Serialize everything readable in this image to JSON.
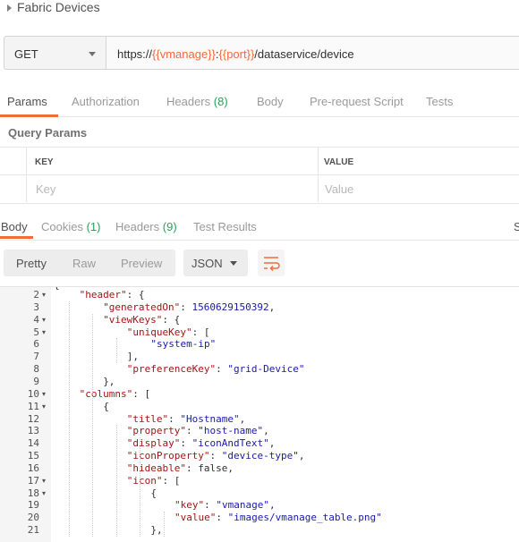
{
  "request": {
    "title": "Fabric Devices",
    "method": "GET",
    "url": {
      "prefix": "https://",
      "var1": "{{vmanage}}",
      "sep": ":",
      "var2": "{{port}}",
      "path": "/dataservice/device"
    }
  },
  "request_tabs": {
    "params": "Params",
    "authorization": "Authorization",
    "headers": "Headers",
    "headers_count": "(8)",
    "body": "Body",
    "prerequest": "Pre-request Script",
    "tests": "Tests"
  },
  "query_params": {
    "title": "Query Params",
    "key_header": "KEY",
    "value_header": "VALUE",
    "key_placeholder": "Key",
    "value_placeholder": "Value"
  },
  "response_tabs": {
    "body": "Body",
    "cookies": "Cookies",
    "cookies_count": "(1)",
    "headers": "Headers",
    "headers_count": "(9)",
    "test_results": "Test Results",
    "status_partial": "S"
  },
  "toolbar": {
    "pretty": "Pretty",
    "raw": "Raw",
    "preview": "Preview",
    "format": "JSON",
    "wrap_icon": "wrap-lines-icon"
  },
  "code": {
    "top_partial": "{",
    "lines": [
      {
        "n": "2",
        "fold": true,
        "key": "\"header\"",
        "rest": ": {"
      },
      {
        "n": "3",
        "fold": false,
        "key": "\"generatedOn\"",
        "rest": ": ",
        "num": "1560629150392",
        "tail": ","
      },
      {
        "n": "4",
        "fold": true,
        "key": "\"viewKeys\"",
        "rest": ": {"
      },
      {
        "n": "5",
        "fold": true,
        "key": "\"uniqueKey\"",
        "rest": ": ["
      },
      {
        "n": "6",
        "fold": false,
        "str": "\"system-ip\""
      },
      {
        "n": "7",
        "fold": false,
        "plain": "],"
      },
      {
        "n": "8",
        "fold": false,
        "key": "\"preferenceKey\"",
        "rest": ": ",
        "str": "\"grid-Device\""
      },
      {
        "n": "9",
        "fold": false,
        "plain": "},"
      },
      {
        "n": "10",
        "fold": true,
        "key": "\"columns\"",
        "rest": ": ["
      },
      {
        "n": "11",
        "fold": true,
        "plain": "{"
      },
      {
        "n": "12",
        "fold": false,
        "key": "\"title\"",
        "rest": ": ",
        "str": "\"Hostname\"",
        "tail": ","
      },
      {
        "n": "13",
        "fold": false,
        "key": "\"property\"",
        "rest": ": ",
        "str": "\"host-name\"",
        "tail": ","
      },
      {
        "n": "14",
        "fold": false,
        "key": "\"display\"",
        "rest": ": ",
        "str": "\"iconAndText\"",
        "tail": ","
      },
      {
        "n": "15",
        "fold": false,
        "key": "\"iconProperty\"",
        "rest": ": ",
        "str": "\"device-type\"",
        "tail": ","
      },
      {
        "n": "16",
        "fold": false,
        "key": "\"hideable\"",
        "rest": ": false,"
      },
      {
        "n": "17",
        "fold": true,
        "key": "\"icon\"",
        "rest": ": ["
      },
      {
        "n": "18",
        "fold": true,
        "plain": "{"
      },
      {
        "n": "19",
        "fold": false,
        "key": "\"key\"",
        "rest": ": ",
        "str": "\"vmanage\"",
        "tail": ","
      },
      {
        "n": "20",
        "fold": false,
        "key": "\"value\"",
        "rest": ": ",
        "str": "\"images/vmanage_table.png\""
      },
      {
        "n": "21",
        "fold": false,
        "plain": "},"
      }
    ]
  },
  "colors": {
    "accent": "#f26b3a",
    "count_green": "#27a35a",
    "json_key": "#a31515",
    "json_value": "#1a1aa6"
  }
}
